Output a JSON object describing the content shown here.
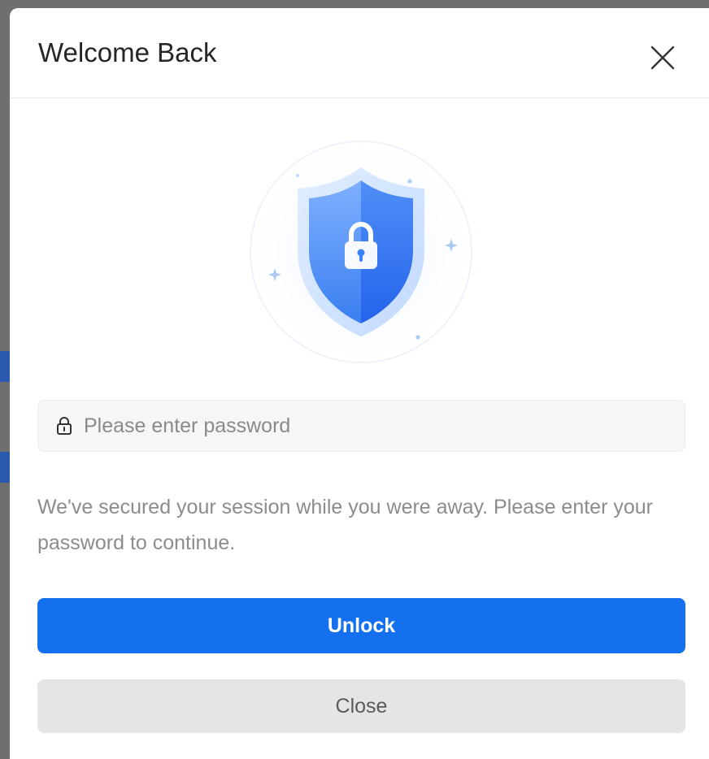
{
  "dialog": {
    "title": "Welcome Back",
    "close_icon": "close-x-icon",
    "hero_icon": "shield-lock-icon"
  },
  "password": {
    "placeholder": "Please enter password",
    "value": "",
    "icon": "lock-icon"
  },
  "message": "We've secured your session while you were away. Please enter your password to continue.",
  "buttons": {
    "unlock_label": "Unlock",
    "close_label": "Close"
  },
  "colors": {
    "primary": "#1570ef",
    "secondary_button": "#e5e5e5",
    "muted_text": "#8c8c8c",
    "shield_blue": "#3b82f6"
  }
}
